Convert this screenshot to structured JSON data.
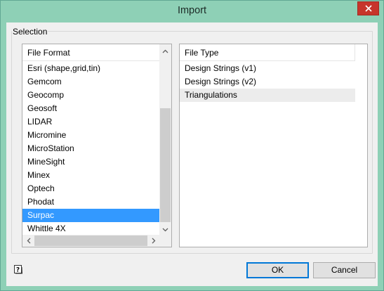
{
  "window": {
    "title": "Import"
  },
  "selection": {
    "group_label": "Selection",
    "file_format": {
      "header": "File Format",
      "items": [
        "Esri (shape,grid,tin)",
        "Gemcom",
        "Geocomp",
        "Geosoft",
        "LIDAR",
        "Micromine",
        "MicroStation",
        "MineSight",
        "Minex",
        "Optech",
        "Phodat",
        "Surpac",
        "Whittle 4X"
      ],
      "selected": "Surpac"
    },
    "file_type": {
      "header": "File Type",
      "items": [
        "Design Strings (v1)",
        "Design Strings (v2)",
        "Triangulations"
      ],
      "highlighted": "Triangulations"
    }
  },
  "buttons": {
    "ok": "OK",
    "cancel": "Cancel"
  },
  "icons": {
    "close": "close-icon",
    "help": "help-icon"
  },
  "colors": {
    "selection": "#3399ff",
    "close_button": "#c7352b",
    "titlebar": "#8ed0b6"
  }
}
